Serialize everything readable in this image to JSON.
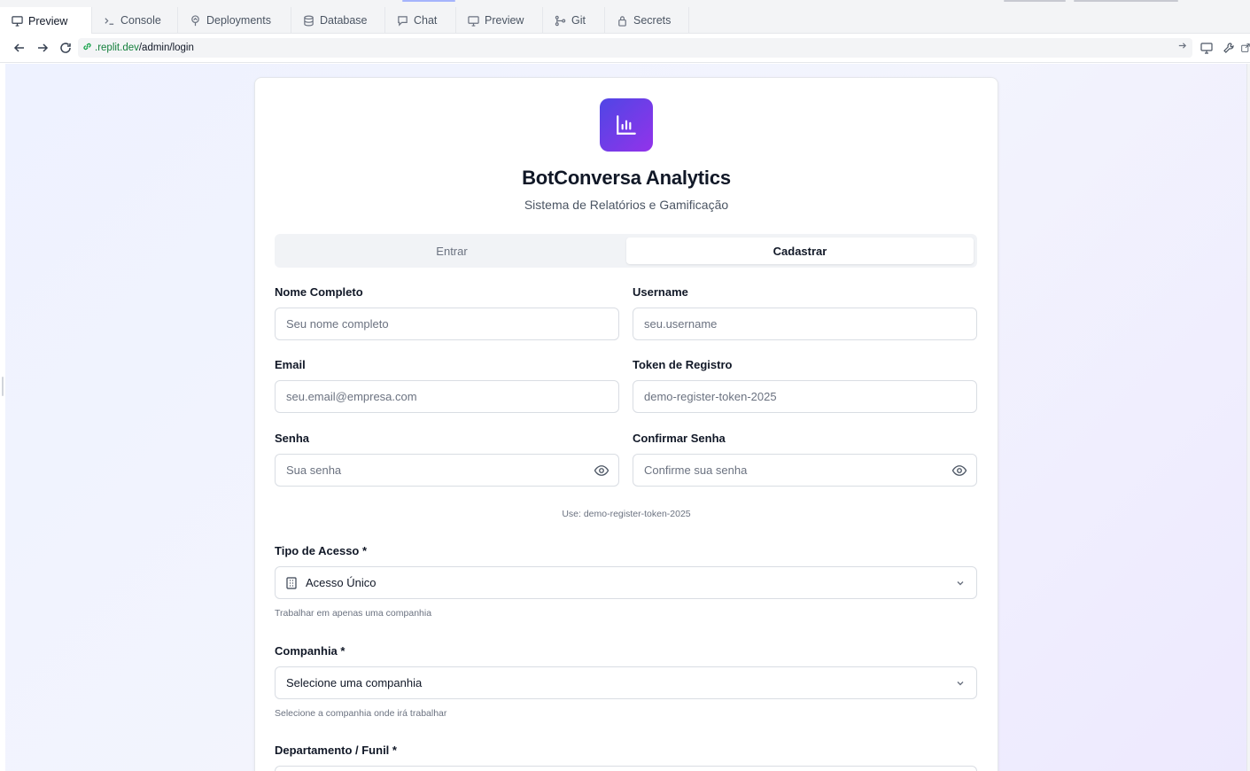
{
  "tabs": [
    {
      "label": "Preview",
      "icon": "monitor-icon",
      "active": true
    },
    {
      "label": "Console",
      "icon": "terminal-icon",
      "active": false
    },
    {
      "label": "Deployments",
      "icon": "deploy-icon",
      "active": false
    },
    {
      "label": "Database",
      "icon": "database-icon",
      "active": false
    },
    {
      "label": "Chat",
      "icon": "chat-icon",
      "active": false
    },
    {
      "label": "Preview",
      "icon": "monitor-icon",
      "active": false
    },
    {
      "label": "Git",
      "icon": "git-icon",
      "active": false
    },
    {
      "label": "Secrets",
      "icon": "lock-icon",
      "active": false
    }
  ],
  "url": {
    "domain": ".replit.dev",
    "path": "/admin/login"
  },
  "app": {
    "title": "BotConversa Analytics",
    "subtitle": "Sistema de Relatórios e Gamificação",
    "accent_from": "#4f46e5",
    "accent_to": "#9333ea"
  },
  "auth_tabs": {
    "login": "Entrar",
    "register": "Cadastrar",
    "selected": "register"
  },
  "form": {
    "full_name": {
      "label": "Nome Completo",
      "placeholder": "Seu nome completo"
    },
    "username": {
      "label": "Username",
      "placeholder": "seu.username"
    },
    "email": {
      "label": "Email",
      "placeholder": "seu.email@empresa.com"
    },
    "token": {
      "label": "Token de Registro",
      "placeholder": "demo-register-token-2025"
    },
    "password": {
      "label": "Senha",
      "placeholder": "Sua senha"
    },
    "confirm_password": {
      "label": "Confirmar Senha",
      "placeholder": "Confirme sua senha"
    },
    "token_hint": "Use: demo-register-token-2025",
    "access_type": {
      "label": "Tipo de Acesso *",
      "value": "Acesso Único",
      "hint": "Trabalhar em apenas uma companhia"
    },
    "company": {
      "label": "Companhia *",
      "value": "Selecione uma companhia",
      "hint": "Selecione a companhia onde irá trabalhar"
    },
    "department": {
      "label": "Departamento / Funil *"
    }
  }
}
